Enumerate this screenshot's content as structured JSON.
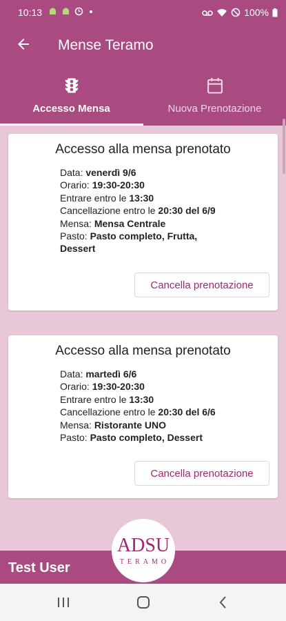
{
  "status_bar": {
    "time": "10:13",
    "battery": "100%",
    "icons_left": [
      "android-icon",
      "android-icon",
      "clock-icon",
      "dot-icon"
    ],
    "icons_right": [
      "voicemail-icon",
      "wifi-icon",
      "do-not-disturb-icon",
      "battery-icon"
    ]
  },
  "app_bar": {
    "title": "Mense Teramo",
    "back_icon": "arrow-left-icon"
  },
  "tabs": [
    {
      "label": "Accesso Mensa",
      "icon": "traffic-light-icon",
      "active": true
    },
    {
      "label": "Nuova Prenotazione",
      "icon": "calendar-icon",
      "active": false
    }
  ],
  "bookings": [
    {
      "title": "Accesso alla mensa prenotato",
      "data_label": "Data:",
      "data_value": "venerdì 9/6",
      "orario_label": "Orario:",
      "orario_value": "19:30-20:30",
      "entrare_label": "Entrare entro le",
      "entrare_value": "13:30",
      "cancellazione_label": "Cancellazione entro le",
      "cancellazione_value": "20:30 del 6/9",
      "mensa_label": "Mensa:",
      "mensa_value": "Mensa Centrale",
      "pasto_label": "Pasto:",
      "pasto_value": "Pasto completo, Frutta, Dessert",
      "cancel_label": "Cancella prenotazione"
    },
    {
      "title": "Accesso alla mensa prenotato",
      "data_label": "Data:",
      "data_value": "martedì 6/6",
      "orario_label": "Orario:",
      "orario_value": "19:30-20:30",
      "entrare_label": "Entrare entro le",
      "entrare_value": "13:30",
      "cancellazione_label": "Cancellazione entro le",
      "cancellazione_value": "20:30 del 6/6",
      "mensa_label": "Mensa:",
      "mensa_value": "Ristorante UNO",
      "pasto_label": "Pasto:",
      "pasto_value": "Pasto completo, Dessert",
      "cancel_label": "Cancella prenotazione"
    }
  ],
  "footer": {
    "user": "Test User",
    "logo_top": "ADSU",
    "logo_bottom": "TERAMO"
  },
  "colors": {
    "primary": "#a94a80",
    "background": "#e8c8d8",
    "accent_text": "#9c2a6e"
  }
}
